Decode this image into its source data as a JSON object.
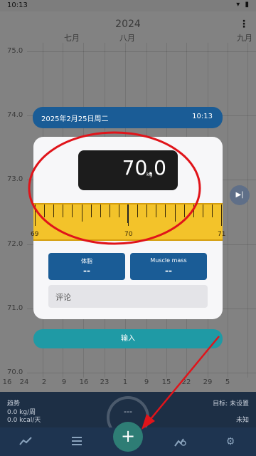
{
  "status_bar": {
    "time": "10:13",
    "icons": "▾ ▮"
  },
  "chart": {
    "year": "2024",
    "months": [
      "七月",
      "八月",
      "九月"
    ],
    "y_labels": [
      "75.0",
      "74.0",
      "73.0",
      "72.0",
      "71.0",
      "70.0"
    ],
    "x_ticks": [
      "16",
      "24",
      "2",
      "9",
      "16",
      "23",
      "1",
      "9",
      "15",
      "22",
      "29",
      "5"
    ]
  },
  "info_bar": {
    "trend_label": "趋势",
    "trend_week": "0.0 kg/周",
    "trend_day": "0.0 kcal/天",
    "gauge_value": "---",
    "target": "目标: 未设置",
    "unknown": "未知"
  },
  "dialog": {
    "date": "2025年2月25日周二",
    "time": "10:13",
    "weight_value": "70.0",
    "weight_unit": "kg",
    "ruler_labels": [
      "69",
      "70",
      "71"
    ],
    "body_fat_label": "体脂",
    "body_fat_value": "--",
    "muscle_label": "Muscle mass",
    "muscle_value": "--",
    "comment_placeholder": "评论",
    "enter_label": "输入"
  },
  "nav": {
    "fab": "+"
  },
  "colors": {
    "accent_blue": "#1a5c96",
    "teal": "#1f9aa5",
    "ruler": "#f3c32a",
    "annotation": "#e0141a"
  }
}
